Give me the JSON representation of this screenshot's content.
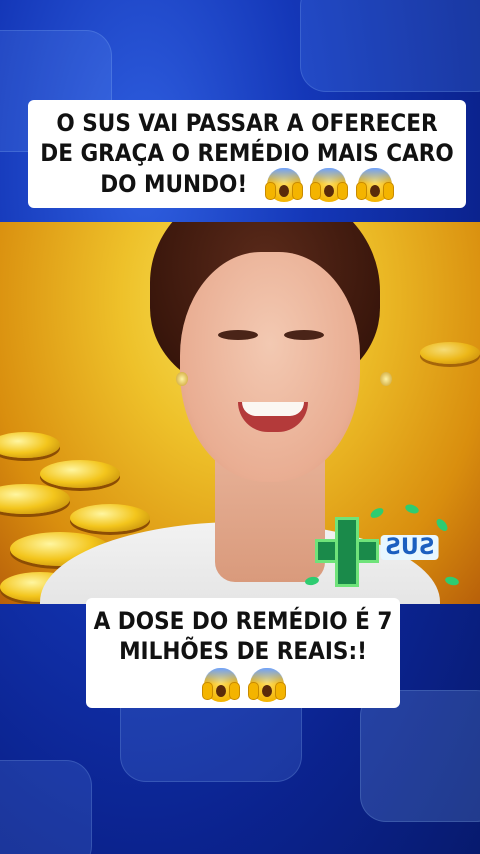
{
  "caption_top": {
    "line1": "O SUS VAI PASSAR A OFERECER",
    "line2": "DE GRAÇA O REMÉDIO MAIS CARO",
    "line3": "DO MUNDO!",
    "emoji_count": 3,
    "emoji": "face-screaming-in-fear"
  },
  "caption_bottom": {
    "line1": "A DOSE DO REMÉDIO É 7",
    "line2": "MILHÕES DE REAIS:!",
    "emoji_count": 2,
    "emoji": "face-screaming-in-fear"
  },
  "logo": {
    "text": "SUS",
    "name": "sus-logo"
  },
  "colors": {
    "background": "#1437b8",
    "caption_bg": "#ffffff",
    "caption_text": "#111111",
    "photo_bg": "#eec12a"
  }
}
